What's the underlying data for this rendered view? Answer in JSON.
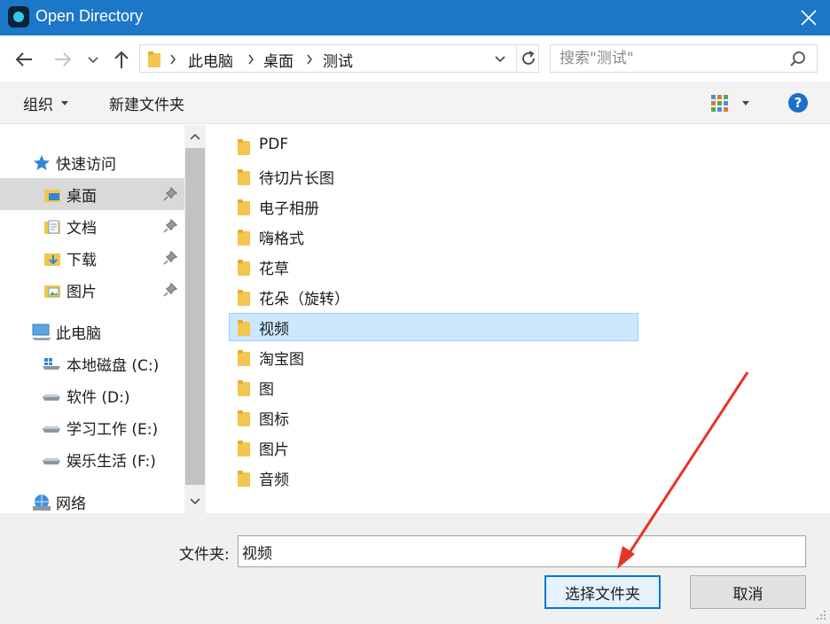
{
  "window": {
    "title": "Open Directory"
  },
  "breadcrumbs": [
    "此电脑",
    "桌面",
    "测试"
  ],
  "search": {
    "placeholder": "搜索\"测试\""
  },
  "toolbar": {
    "organize": "组织",
    "new_folder": "新建文件夹"
  },
  "nav": {
    "quick_access": "快速访问",
    "quick_items": [
      "桌面",
      "文档",
      "下载",
      "图片"
    ],
    "this_pc": "此电脑",
    "drives": [
      "本地磁盘 (C:)",
      "软件 (D:)",
      "学习工作 (E:)",
      "娱乐生活 (F:)"
    ],
    "network": "网络",
    "selected": "桌面"
  },
  "folders": [
    "PDF",
    "待切片长图",
    "电子相册",
    "嗨格式",
    "花草",
    "花朵（旋转）",
    "视频",
    "淘宝图",
    "图",
    "图标",
    "图片",
    "音频"
  ],
  "selected_folder": "视频",
  "footer": {
    "folder_label": "文件夹:",
    "folder_value": "视频",
    "select_button": "选择文件夹",
    "cancel_button": "取消"
  },
  "colors": {
    "titlebar": "#1d77c8",
    "selection": "#cce8ff",
    "folder": "#f4c54f",
    "annotation_arrow": "#e8332a"
  }
}
